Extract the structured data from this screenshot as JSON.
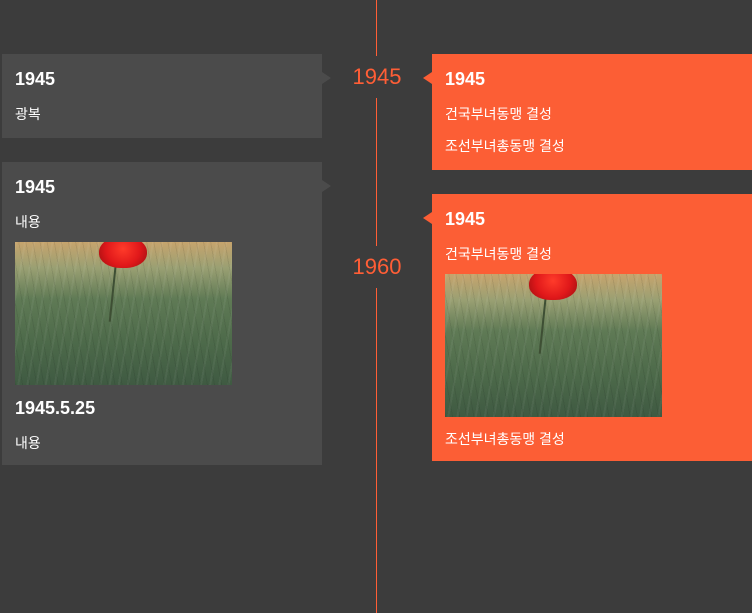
{
  "timeline": {
    "axis_color": "#ff5e36",
    "years": [
      {
        "label": "1945"
      },
      {
        "label": "1960"
      }
    ]
  },
  "left_cards": [
    {
      "title": "1945",
      "text": "광복"
    },
    {
      "title": "1945",
      "text": "내용",
      "image_icon": "poppy-photo",
      "subtitle": "1945.5.25",
      "text2": "내용"
    }
  ],
  "right_cards": [
    {
      "title": "1945",
      "line1": "건국부녀동맹 결성",
      "line2": "조선부녀총동맹 결성"
    },
    {
      "title": "1945",
      "line1": "건국부녀동맹 결성",
      "image_icon": "poppy-photo",
      "line2": "조선부녀총동맹 결성"
    }
  ],
  "colors": {
    "background": "#3c3c3c",
    "left_card": "#4b4b4b",
    "right_card": "#fc5e35",
    "accent": "#ff5e36"
  }
}
